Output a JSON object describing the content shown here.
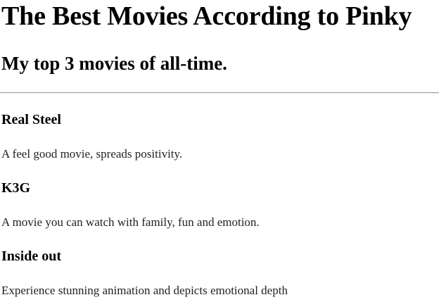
{
  "page": {
    "title": "The Best Movies According to Pinky",
    "subtitle": "My top 3 movies of all-time."
  },
  "movies": [
    {
      "title": "Real Steel",
      "description": "A feel good movie, spreads positivity."
    },
    {
      "title": "K3G",
      "description": "A movie you can watch with family, fun and emotion."
    },
    {
      "title": "Inside out",
      "description": "Experience stunning animation and depicts emotional depth"
    }
  ]
}
